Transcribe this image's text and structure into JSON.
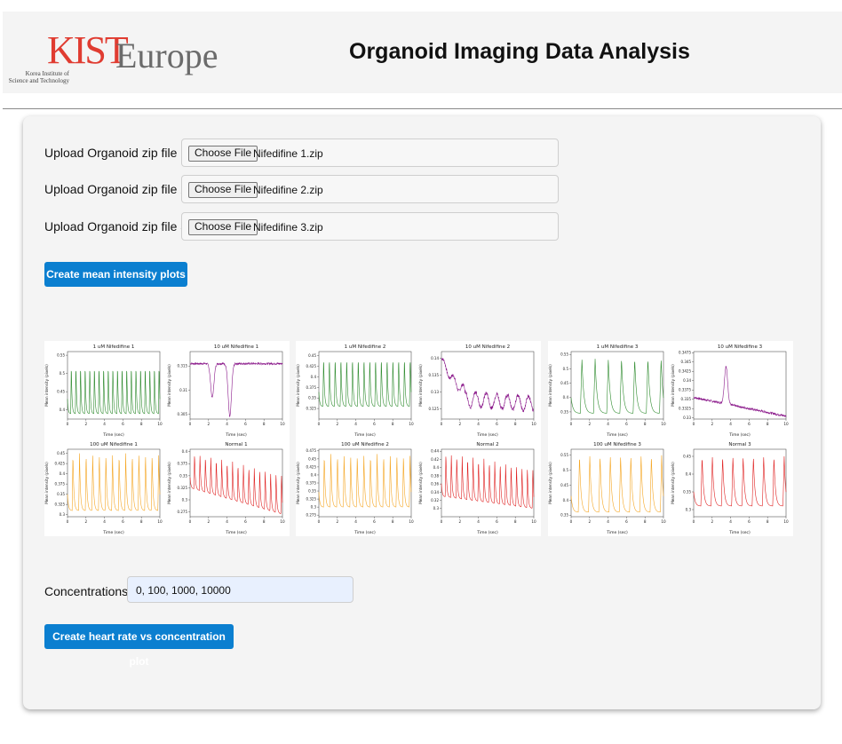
{
  "header": {
    "logo_mark": "KIST",
    "logo_word": "Europe",
    "logo_sub_line1": "Korea Institute of",
    "logo_sub_line2": "Science and Technology",
    "title": "Organoid Imaging Data Analysis"
  },
  "uploads": [
    {
      "label": "Upload Organoid zip file 1:",
      "button": "Choose File",
      "file": "Nifedifine 1.zip"
    },
    {
      "label": "Upload Organoid zip file 2:",
      "button": "Choose File",
      "file": "Nifedifine 2.zip"
    },
    {
      "label": "Upload Organoid zip file 3:",
      "button": "Choose File",
      "file": "Nifedifine 3.zip"
    }
  ],
  "create_mean_button": "Create mean intensity plots",
  "concentrations": {
    "label": "Concentrations:",
    "value": "0, 100, 1000, 10000"
  },
  "create_hr_button": "Create heart rate vs concentration plot",
  "colors": {
    "green": "#2e8b2e",
    "purple": "#8b1a8b",
    "orange": "#f5a623",
    "red": "#e02020",
    "accent": "#0b7fd0"
  },
  "chart_data": [
    {
      "type": "line",
      "title": "1 uM Nifedifine 1",
      "xlabel": "Time (sec)",
      "ylabel": "Mean intensity (pixels)",
      "xlim": [
        0,
        10
      ],
      "ylim": [
        0.375,
        0.56
      ],
      "xticks": [
        0,
        2,
        4,
        6,
        8,
        10
      ],
      "yticks": [
        0.4,
        0.45,
        0.5,
        0.55
      ],
      "color": "#2e8b2e",
      "pattern": {
        "kind": "spikes",
        "count": 20,
        "base": 0.39,
        "peak": 0.53
      }
    },
    {
      "type": "line",
      "title": "10 uM Nifedifine 1",
      "xlabel": "Time (sec)",
      "ylabel": "Mean intensity (pixels)",
      "xlim": [
        0,
        10
      ],
      "ylim": [
        0.304,
        0.318
      ],
      "xticks": [
        0,
        2,
        4,
        6,
        8,
        10
      ],
      "yticks": [
        0.305,
        0.31,
        0.315
      ],
      "color": "#8b1a8b",
      "pattern": {
        "kind": "dips",
        "base": 0.3155,
        "dips": [
          [
            2.4,
            0.3085
          ],
          [
            4.3,
            0.3045
          ]
        ]
      }
    },
    {
      "type": "line",
      "title": "100 uM Nifedifine 1",
      "xlabel": "Time (sec)",
      "ylabel": "Mean intensity (pixels)",
      "xlim": [
        0,
        10
      ],
      "ylim": [
        0.295,
        0.46
      ],
      "xticks": [
        0,
        2,
        4,
        6,
        8,
        10
      ],
      "yticks": [
        0.3,
        0.325,
        0.35,
        0.375,
        0.4,
        0.425,
        0.45
      ],
      "color": "#f5a623",
      "pattern": {
        "kind": "spikes",
        "count": 14,
        "base": 0.31,
        "peak": 0.45
      }
    },
    {
      "type": "line",
      "title": "Normal 1",
      "xlabel": "Time (sec)",
      "ylabel": "Mean intensity (pixels)",
      "xlim": [
        0,
        10
      ],
      "ylim": [
        0.265,
        0.405
      ],
      "xticks": [
        0,
        2,
        4,
        6,
        8,
        10
      ],
      "yticks": [
        0.275,
        0.3,
        0.325,
        0.35,
        0.375,
        0.4
      ],
      "color": "#e02020",
      "pattern": {
        "kind": "spikes-decay",
        "count": 17,
        "base": 0.325,
        "peak": 0.4,
        "end_base": 0.27,
        "end_peak": 0.355
      }
    },
    {
      "type": "line",
      "title": "1 uM Nifedifine 2",
      "xlabel": "Time (sec)",
      "ylabel": "Mean intensity (pixels)",
      "xlim": [
        0,
        10
      ],
      "ylim": [
        0.3,
        0.46
      ],
      "xticks": [
        0,
        2,
        4,
        6,
        8,
        10
      ],
      "yticks": [
        0.325,
        0.35,
        0.375,
        0.4,
        0.425,
        0.45
      ],
      "color": "#2e8b2e",
      "pattern": {
        "kind": "spikes",
        "count": 16,
        "base": 0.33,
        "peak": 0.45
      }
    },
    {
      "type": "line",
      "title": "10 uM Nifedifine 2",
      "xlabel": "Time (sec)",
      "ylabel": "Mean intensity (pixels)",
      "xlim": [
        0,
        10
      ],
      "ylim": [
        0.122,
        0.142
      ],
      "xticks": [
        0,
        2,
        4,
        6,
        8,
        10
      ],
      "yticks": [
        0.125,
        0.13,
        0.135,
        0.14
      ],
      "color": "#8b1a8b",
      "pattern": {
        "kind": "noisy-decay",
        "start": 0.14,
        "mid": 0.128,
        "end": 0.1265
      }
    },
    {
      "type": "line",
      "title": "100 uM Nifedifine 2",
      "xlabel": "Time (sec)",
      "ylabel": "Mean intensity (pixels)",
      "xlim": [
        0,
        10
      ],
      "ylim": [
        0.27,
        0.48
      ],
      "xticks": [
        0,
        2,
        4,
        6,
        8,
        10
      ],
      "yticks": [
        0.275,
        0.3,
        0.325,
        0.35,
        0.375,
        0.4,
        0.425,
        0.45,
        0.475
      ],
      "color": "#f5a623",
      "pattern": {
        "kind": "spikes",
        "count": 14,
        "base": 0.3,
        "peak": 0.465
      }
    },
    {
      "type": "line",
      "title": "Normal 2",
      "xlabel": "Time (sec)",
      "ylabel": "Mean intensity (pixels)",
      "xlim": [
        0,
        10
      ],
      "ylim": [
        0.28,
        0.445
      ],
      "xticks": [
        0,
        2,
        4,
        6,
        8,
        10
      ],
      "yticks": [
        0.3,
        0.32,
        0.34,
        0.36,
        0.38,
        0.4,
        0.42,
        0.44
      ],
      "color": "#e02020",
      "pattern": {
        "kind": "spikes-decay",
        "count": 17,
        "base": 0.33,
        "peak": 0.44,
        "end_base": 0.3,
        "end_peak": 0.4
      }
    },
    {
      "type": "line",
      "title": "1 uM Nifedifine 3",
      "xlabel": "Time (sec)",
      "ylabel": "Mean intensity (pixels)",
      "xlim": [
        0,
        10
      ],
      "ylim": [
        0.325,
        0.56
      ],
      "xticks": [
        0,
        2,
        4,
        6,
        8,
        10
      ],
      "yticks": [
        0.35,
        0.4,
        0.45,
        0.5,
        0.55
      ],
      "color": "#2e8b2e",
      "pattern": {
        "kind": "spikes",
        "count": 7,
        "base": 0.345,
        "peak": 0.535
      }
    },
    {
      "type": "line",
      "title": "10 uM Nifedifine 3",
      "xlabel": "Time (sec)",
      "ylabel": "Mean intensity (pixels)",
      "xlim": [
        0,
        10
      ],
      "ylim": [
        0.3297,
        0.3478
      ],
      "xticks": [
        0,
        2,
        4,
        6,
        8,
        10
      ],
      "yticks": [
        0.33,
        0.3325,
        0.335,
        0.3375,
        0.34,
        0.3425,
        0.345,
        0.3475
      ],
      "color": "#8b1a8b",
      "pattern": {
        "kind": "bump",
        "base": 0.3355,
        "end": 0.3305,
        "peak_x": 3.5,
        "peak": 0.3455
      }
    },
    {
      "type": "line",
      "title": "100 uM Nifedifine 3",
      "xlabel": "Time (sec)",
      "ylabel": "Mean intensity (pixels)",
      "xlim": [
        0,
        10
      ],
      "ylim": [
        0.345,
        0.57
      ],
      "xticks": [
        0,
        2,
        4,
        6,
        8,
        10
      ],
      "yticks": [
        0.35,
        0.4,
        0.45,
        0.5,
        0.55
      ],
      "color": "#f5a623",
      "pattern": {
        "kind": "spikes",
        "count": 9,
        "base": 0.36,
        "peak": 0.55
      }
    },
    {
      "type": "line",
      "title": "Normal 3",
      "xlabel": "Time (sec)",
      "ylabel": "Mean intensity (pixels)",
      "xlim": [
        0,
        10
      ],
      "ylim": [
        0.28,
        0.47
      ],
      "xticks": [
        0,
        2,
        4,
        6,
        8,
        10
      ],
      "yticks": [
        0.3,
        0.35,
        0.4,
        0.45
      ],
      "color": "#e02020",
      "pattern": {
        "kind": "spikes",
        "count": 9,
        "base": 0.31,
        "peak": 0.45
      }
    }
  ]
}
